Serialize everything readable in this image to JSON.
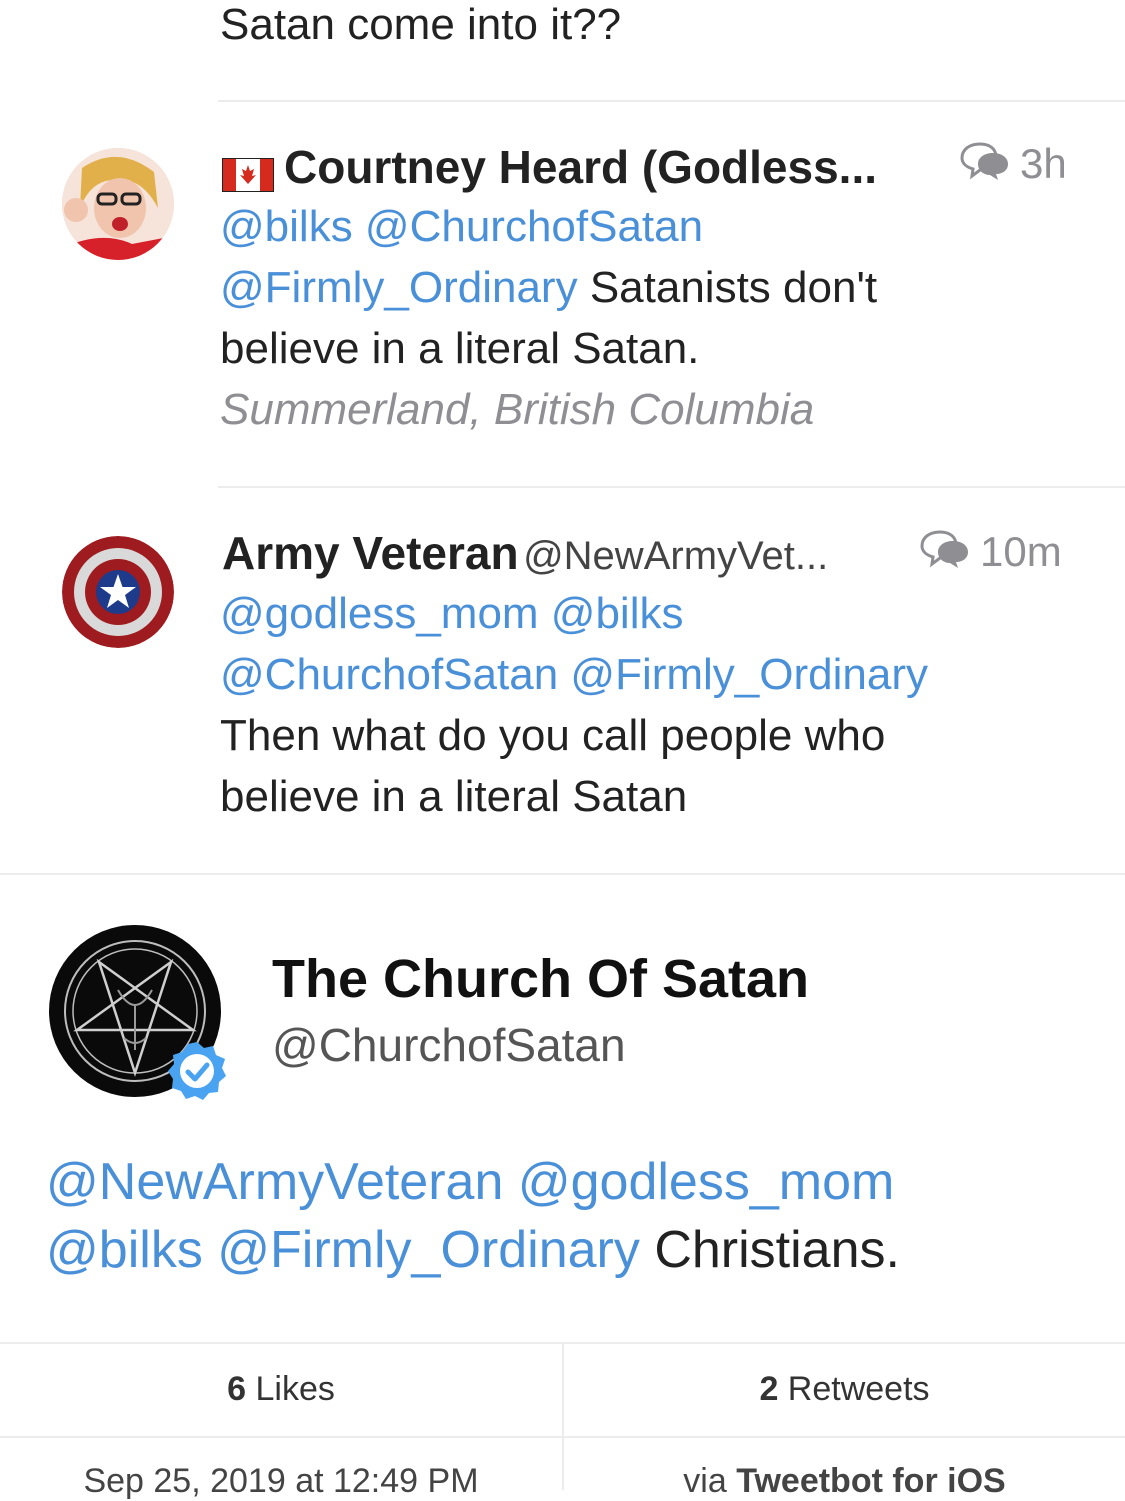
{
  "top_fragment": "Satan come into it??",
  "reply1": {
    "flag": "canada-flag",
    "name": "Courtney Heard (Godless...",
    "time": "3h",
    "mentions_line1": "@bilks @ChurchofSatan",
    "mention_line2": "@Firmly_Ordinary",
    "text_line2": " Satanists don't",
    "text_line3": "believe in a literal Satan.",
    "location": "Summerland, British Columbia"
  },
  "reply2": {
    "name": "Army Veteran",
    "handle": "@NewArmyVet...",
    "time": "10m",
    "mentions_line1": "@godless_mom @bilks",
    "mentions_line2": "@ChurchofSatan @Firmly_Ordinary",
    "text_line3": "Then what do you call people who",
    "text_line4": "believe in a literal Satan"
  },
  "main_tweet": {
    "name": "The Church Of Satan",
    "handle": "@ChurchofSatan",
    "verified": true,
    "mentions_line1": "@NewArmyVeteran @godless_mom",
    "mentions_line2": "@bilks @Firmly_Ordinary",
    "text_line2": " Christians.",
    "likes_count": "6",
    "likes_label": " Likes",
    "retweets_count": "2",
    "retweets_label": " Retweets",
    "date": "Sep 25, 2019 at 12:49 PM",
    "via_prefix": "via ",
    "via_app": "Tweetbot for iOS"
  },
  "colors": {
    "link": "#4a90d9",
    "verified": "#4aa3f0",
    "separator": "#ececec"
  }
}
